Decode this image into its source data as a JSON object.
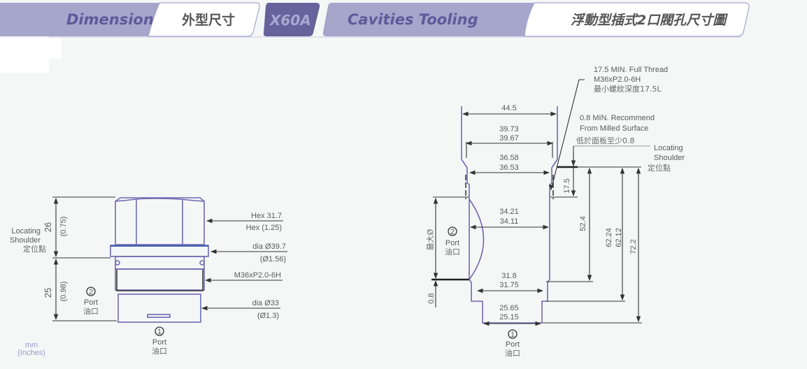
{
  "header": {
    "tab1_en": "Dimension",
    "tab1_zh": "外型尺寸",
    "model": "X60A",
    "tab2_en": "Cavities Tooling",
    "tab2_zh": "浮動型插式2口閥孔尺寸圖",
    "colors": {
      "band": "#a6a5cc",
      "model_bg": "#66629b",
      "model_text": "#a9a8d2",
      "en_text": "#5e5a9a",
      "zh_text": "#555555"
    }
  },
  "left_drawing": {
    "shoulder_label": [
      "Locating",
      "Shoulder",
      "定位點"
    ],
    "dim_upper": {
      "mm": "26",
      "inch": "(0.75)"
    },
    "dim_lower": {
      "mm": "25",
      "inch": "(0.98)"
    },
    "callouts": [
      {
        "line1": "Hex  31.7",
        "line2": "Hex  (1.25)"
      },
      {
        "line1": "dia  Ø39.7",
        "line2": "(Ø1.56)"
      },
      {
        "line1": "M36xP2.0-6H",
        "line2": ""
      },
      {
        "line1": "dia  Ø33",
        "line2": "(Ø1.3)"
      }
    ],
    "port2": {
      "num": "2",
      "en": "Port",
      "zh": "油口"
    },
    "port1": {
      "num": "1",
      "en": "Port",
      "zh": "油口"
    },
    "units": {
      "top": "mm",
      "bottom": "(Inches)"
    }
  },
  "right_drawing": {
    "thread_note": [
      "17.5 MIN. Full Thread",
      "M36xP2.0-6H",
      "最小螺紋深度17.5L"
    ],
    "surface_note": [
      "0.8 MIN. Recommend",
      "From Milled Surface",
      "低於面板至少0.8"
    ],
    "shoulder_label": [
      "Locating",
      "Shoulder",
      "定位點"
    ],
    "widths": {
      "w1": "44.5",
      "w2": [
        "39.73",
        "39.67"
      ],
      "w3": [
        "36.58",
        "36.53"
      ],
      "w4": [
        "34.21",
        "34.11"
      ],
      "w5": [
        "31.8",
        "31.75"
      ],
      "w6": [
        "25.65",
        "25.15"
      ]
    },
    "depths": {
      "thread": "17.5",
      "d1": "52.4",
      "d2": [
        "62.24",
        "62.12"
      ],
      "d3": "72.2",
      "surface": "0.8",
      "max_dia": "最大Ø"
    },
    "port2": {
      "num": "2",
      "en": "Port",
      "zh": "油口"
    },
    "port1": {
      "num": "1",
      "en": "Port",
      "zh": "油口"
    }
  }
}
